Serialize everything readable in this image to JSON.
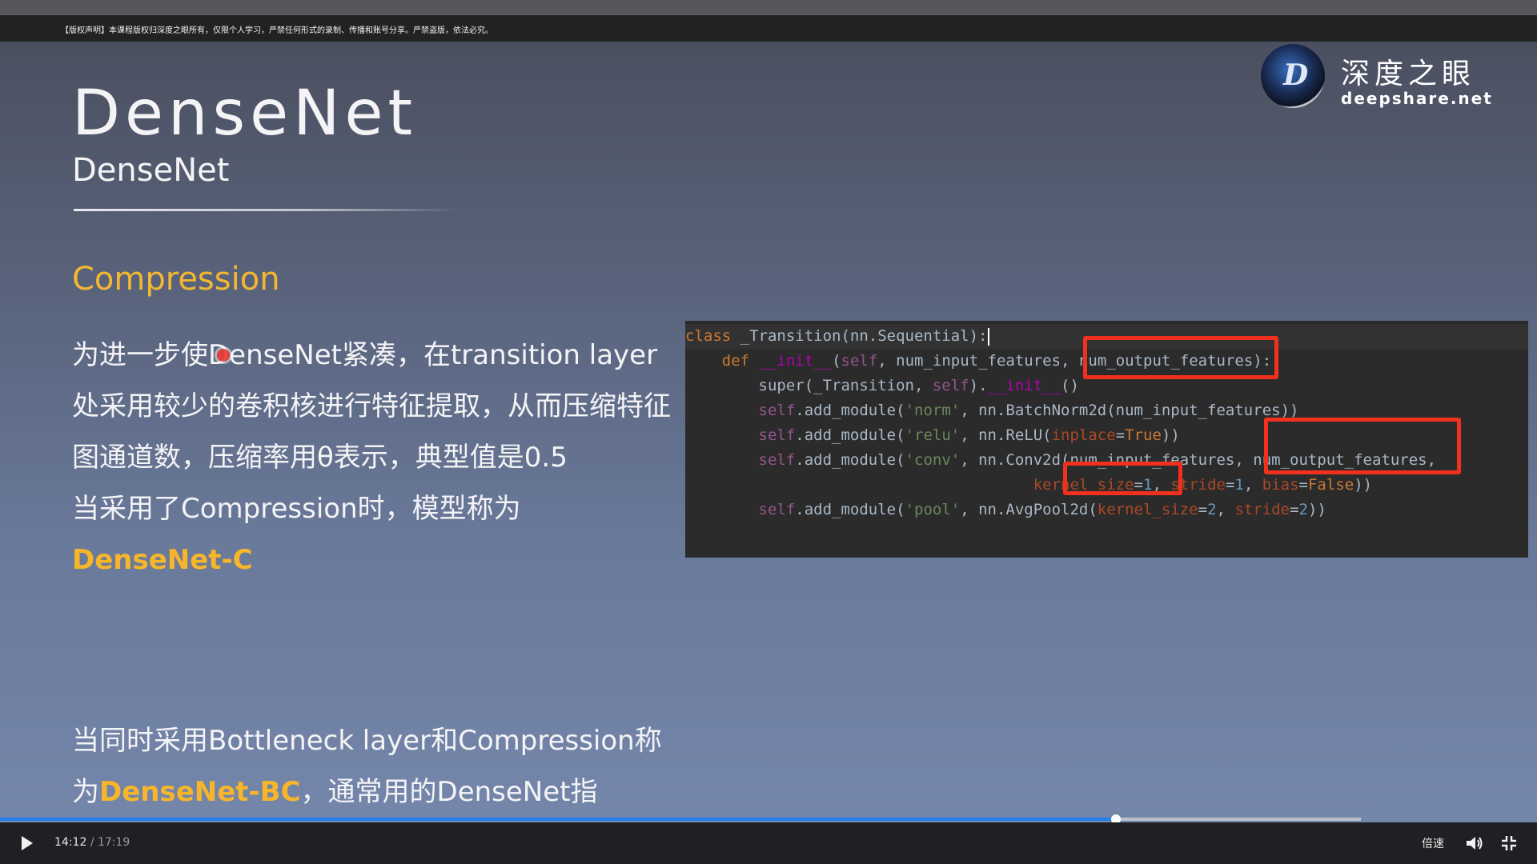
{
  "notice": "【版权声明】本课程版权归深度之眼所有，仅限个人学习，严禁任何形式的录制、传播和账号分享。严禁盗版，依法必究。",
  "logo": {
    "name_cn": "深度之眼",
    "name_en": "deepshare.net",
    "mark": "D"
  },
  "slide": {
    "title": "DenseNet",
    "subtitle": "DenseNet",
    "section_heading": "Compression",
    "para1": {
      "line1": "为进一步使DenseNet紧凑，在transition layer处采用较少的卷积核进行特征提取，从而压缩特征图通道数，压缩率用θ表示，典型值是0.5",
      "line2": "当采用了Compression时，模型称为",
      "highlight": "DenseNet-C"
    },
    "para2": {
      "prefix": "当同时采用Bottleneck layer和Compression称为",
      "highlight": "DenseNet-BC",
      "suffix": "，通常用的DenseNet指DenseNet-BC"
    }
  },
  "code": {
    "l1": {
      "kw": "class",
      "rest": " _Transition(nn.Sequential):"
    },
    "l2": {
      "kw": "def",
      "fn": "__init__",
      "open": "(",
      "self": "self",
      "args": ", num_input_features, num_output_features):"
    },
    "l3": {
      "pre": "super(_Transition, ",
      "self": "self",
      "mid": ").",
      "fn": "__init__",
      "post": "()"
    },
    "l4": {
      "self": "self",
      "a": ".add_module(",
      "str": "'norm'",
      "b": ", nn.BatchNorm2d(num_input_features))"
    },
    "l5": {
      "self": "self",
      "a": ".add_module(",
      "str": "'relu'",
      "b": ", nn.ReLU(",
      "param": "inplace",
      "eq": "=",
      "kw": "True",
      "c": "))"
    },
    "l6": {
      "self": "self",
      "a": ".add_module(",
      "str": "'conv'",
      "b": ", nn.Conv2d(num_input_features, num_output_features,"
    },
    "l7": {
      "p1": "kernel_size",
      "eq1": "=",
      "n1": "1",
      "sep1": ", ",
      "p2": "stride",
      "eq2": "=",
      "n2": "1",
      "sep2": ", ",
      "p3": "bias",
      "eq3": "=",
      "k3": "False",
      "end": "))"
    },
    "l8": {
      "self": "self",
      "a": ".add_module(",
      "str": "'pool'",
      "b": ", nn.AvgPool2d(",
      "p1": "kernel_size",
      "eq1": "=",
      "n1": "2",
      "sep": ", ",
      "p2": "stride",
      "eq2": "=",
      "n2": "2",
      "end": "))"
    }
  },
  "player": {
    "current_time": "14:12",
    "separator": "/",
    "duration": "17:19",
    "progress": 0.82,
    "speed_label": "倍速"
  },
  "colors": {
    "accent_yellow": "#f5b731",
    "progress_blue": "#1f7ff2",
    "annotation_red": "#f2301e"
  }
}
